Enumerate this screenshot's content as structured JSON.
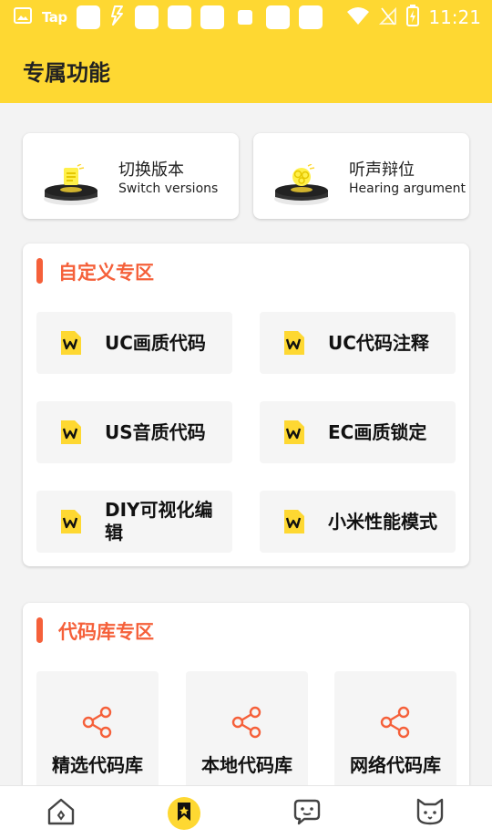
{
  "status_bar": {
    "tap_text": "Tap",
    "time": "11:21"
  },
  "header": {
    "title": "专属功能"
  },
  "feature_cards": [
    {
      "title": "切换版本",
      "subtitle": "Switch versions",
      "icon": "lightbulb-icon"
    },
    {
      "title": "听声辩位",
      "subtitle": "Hearing argument",
      "icon": "brain-icon"
    }
  ],
  "custom_section": {
    "title": "自定义专区",
    "items": [
      {
        "label": "UC画质代码",
        "icon": "w-document-icon"
      },
      {
        "label": "UC代码注释",
        "icon": "w-document-icon"
      },
      {
        "label": "US音质代码",
        "icon": "w-document-icon"
      },
      {
        "label": "EC画质锁定",
        "icon": "w-document-icon"
      },
      {
        "label": "DIY可视化编辑",
        "icon": "w-document-icon"
      },
      {
        "label": "小米性能模式",
        "icon": "w-document-icon"
      }
    ]
  },
  "library_section": {
    "title": "代码库专区",
    "items": [
      {
        "label": "精选代码库",
        "icon": "share-icon"
      },
      {
        "label": "本地代码库",
        "icon": "share-icon"
      },
      {
        "label": "网络代码库",
        "icon": "share-icon"
      }
    ]
  },
  "bottom_nav": {
    "items": [
      {
        "icon": "home-icon",
        "active": false
      },
      {
        "icon": "bookmark-icon",
        "active": true
      },
      {
        "icon": "chat-face-icon",
        "active": false
      },
      {
        "icon": "cat-face-icon",
        "active": false
      }
    ]
  },
  "colors": {
    "brand_yellow": "#fed832",
    "accent_orange": "#f5603a",
    "tile_bg": "#f5f5f5",
    "page_bg": "#f3f3f3"
  }
}
